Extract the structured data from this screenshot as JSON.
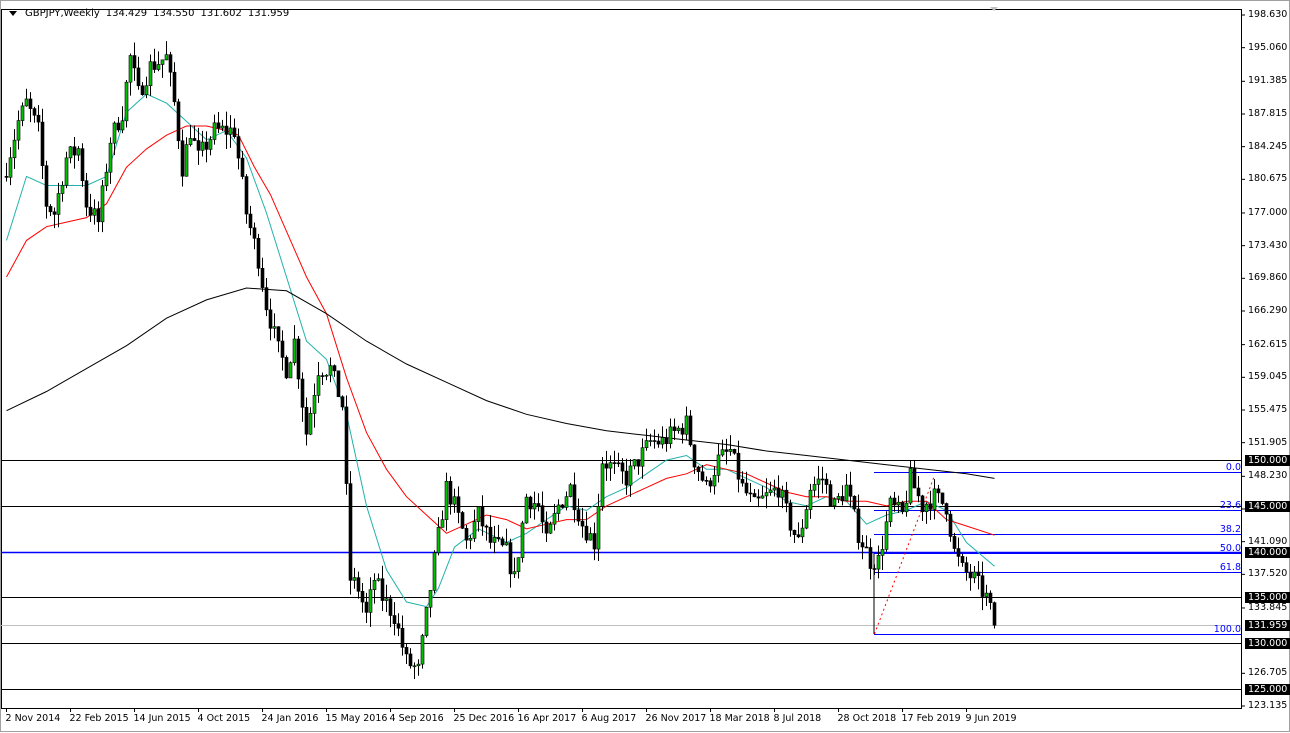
{
  "header": {
    "symbol_timeframe": "GBPJPY,Weekly",
    "open": "134.429",
    "high": "134.550",
    "low": "131.602",
    "close": "131.959"
  },
  "colors": {
    "bull": "#00c000",
    "bear": "#000000",
    "ma_fast": "#20b2aa",
    "ma_mid": "#ff0000",
    "ma_slow": "#000000",
    "fib": "#0000ff",
    "levels": "#000000"
  },
  "chart_data": {
    "type": "candlestick",
    "title": "GBPJPY,Weekly",
    "ylim": [
      123.135,
      198.63
    ],
    "y_ticks": [
      "198.630",
      "195.060",
      "191.385",
      "187.815",
      "184.245",
      "180.675",
      "177.000",
      "173.430",
      "169.860",
      "166.290",
      "162.615",
      "159.045",
      "155.475",
      "151.905",
      "148.230",
      "144.660",
      "141.090",
      "137.520",
      "133.845",
      "126.705",
      "123.135"
    ],
    "x_ticks": [
      {
        "week": 0,
        "label": "2 Nov 2014"
      },
      {
        "week": 16,
        "label": "22 Feb 2015"
      },
      {
        "week": 32,
        "label": "14 Jun 2015"
      },
      {
        "week": 48,
        "label": "4 Oct 2015"
      },
      {
        "week": 64,
        "label": "24 Jan 2016"
      },
      {
        "week": 80,
        "label": "15 May 2016"
      },
      {
        "week": 96,
        "label": "4 Sep 2016"
      },
      {
        "week": 112,
        "label": "25 Dec 2016"
      },
      {
        "week": 128,
        "label": "16 Apr 2017"
      },
      {
        "week": 144,
        "label": "6 Aug 2017"
      },
      {
        "week": 160,
        "label": "26 Nov 2017"
      },
      {
        "week": 176,
        "label": "18 Mar 2018"
      },
      {
        "week": 192,
        "label": "8 Jul 2018"
      },
      {
        "week": 208,
        "label": "28 Oct 2018"
      },
      {
        "week": 224,
        "label": "17 Feb 2019"
      },
      {
        "week": 240,
        "label": "9 Jun 2019"
      }
    ],
    "close_path": [
      [
        0,
        182
      ],
      [
        3,
        187
      ],
      [
        5,
        189
      ],
      [
        8,
        186
      ],
      [
        10,
        178
      ],
      [
        12,
        177
      ],
      [
        15,
        183
      ],
      [
        18,
        184
      ],
      [
        20,
        178
      ],
      [
        23,
        176
      ],
      [
        26,
        185
      ],
      [
        29,
        188
      ],
      [
        31,
        194
      ],
      [
        33,
        190
      ],
      [
        36,
        193
      ],
      [
        40,
        194
      ],
      [
        42,
        189
      ],
      [
        44,
        182
      ],
      [
        46,
        186
      ],
      [
        48,
        183
      ],
      [
        52,
        186
      ],
      [
        57,
        186
      ],
      [
        60,
        177
      ],
      [
        63,
        172
      ],
      [
        65,
        167
      ],
      [
        68,
        162
      ],
      [
        70,
        160
      ],
      [
        72,
        163
      ],
      [
        75,
        153
      ],
      [
        78,
        160
      ],
      [
        81,
        160
      ],
      [
        84,
        156
      ],
      [
        86,
        137
      ],
      [
        88,
        136
      ],
      [
        90,
        133
      ],
      [
        92,
        137
      ],
      [
        94,
        135
      ],
      [
        97,
        133
      ],
      [
        100,
        128
      ],
      [
        103,
        127
      ],
      [
        105,
        133
      ],
      [
        107,
        139
      ],
      [
        110,
        147
      ],
      [
        112,
        145
      ],
      [
        115,
        141
      ],
      [
        118,
        144
      ],
      [
        121,
        141
      ],
      [
        125,
        140
      ],
      [
        127,
        137
      ],
      [
        130,
        146
      ],
      [
        133,
        145
      ],
      [
        135,
        141
      ],
      [
        138,
        145
      ],
      [
        141,
        147
      ],
      [
        144,
        143
      ],
      [
        147,
        141
      ],
      [
        149,
        150
      ],
      [
        152,
        149
      ],
      [
        155,
        148
      ],
      [
        158,
        150
      ],
      [
        161,
        152
      ],
      [
        164,
        152
      ],
      [
        167,
        153
      ],
      [
        170,
        154
      ],
      [
        172,
        150
      ],
      [
        175,
        147
      ],
      [
        178,
        150
      ],
      [
        181,
        151
      ],
      [
        184,
        147
      ],
      [
        187,
        145
      ],
      [
        190,
        146
      ],
      [
        193,
        147
      ],
      [
        196,
        143
      ],
      [
        198,
        141
      ],
      [
        201,
        147
      ],
      [
        204,
        148
      ],
      [
        207,
        145
      ],
      [
        210,
        147
      ],
      [
        213,
        142
      ],
      [
        216,
        139
      ],
      [
        218,
        139
      ],
      [
        221,
        145
      ],
      [
        224,
        144
      ],
      [
        226,
        148
      ],
      [
        229,
        145
      ],
      [
        232,
        146
      ],
      [
        235,
        145
      ],
      [
        237,
        140
      ],
      [
        239,
        138
      ],
      [
        242,
        137
      ],
      [
        245,
        135
      ],
      [
        246,
        134.429
      ]
    ],
    "last_candle": {
      "open": 134.429,
      "high": 134.55,
      "low": 131.602,
      "close": 131.959
    },
    "series": [
      {
        "name": "MA fast",
        "color": "#20b2aa",
        "points": [
          [
            0,
            174
          ],
          [
            5,
            181
          ],
          [
            10,
            180
          ],
          [
            15,
            180
          ],
          [
            20,
            180
          ],
          [
            25,
            181
          ],
          [
            30,
            188
          ],
          [
            35,
            190
          ],
          [
            40,
            189
          ],
          [
            45,
            187
          ],
          [
            50,
            185
          ],
          [
            55,
            186
          ],
          [
            60,
            183
          ],
          [
            65,
            177
          ],
          [
            70,
            170
          ],
          [
            75,
            163
          ],
          [
            80,
            161
          ],
          [
            85,
            155
          ],
          [
            90,
            145
          ],
          [
            95,
            138
          ],
          [
            100,
            134.5
          ],
          [
            105,
            134
          ],
          [
            108,
            136
          ],
          [
            112,
            140.5
          ],
          [
            118,
            142.5
          ],
          [
            125,
            141
          ],
          [
            130,
            142
          ],
          [
            135,
            143.5
          ],
          [
            140,
            145
          ],
          [
            145,
            144.5
          ],
          [
            150,
            146
          ],
          [
            155,
            147
          ],
          [
            160,
            148.5
          ],
          [
            165,
            150
          ],
          [
            170,
            150.5
          ],
          [
            175,
            149
          ],
          [
            180,
            149
          ],
          [
            185,
            148
          ],
          [
            190,
            147
          ],
          [
            195,
            145.5
          ],
          [
            200,
            145
          ],
          [
            205,
            146
          ],
          [
            210,
            145.5
          ],
          [
            215,
            143
          ],
          [
            220,
            144
          ],
          [
            225,
            144.5
          ],
          [
            230,
            145.5
          ],
          [
            235,
            144.5
          ],
          [
            240,
            141
          ],
          [
            247,
            138.4
          ]
        ]
      },
      {
        "name": "MA mid",
        "color": "#ff0000",
        "points": [
          [
            0,
            170
          ],
          [
            5,
            174
          ],
          [
            10,
            175.5
          ],
          [
            15,
            176
          ],
          [
            20,
            176.5
          ],
          [
            25,
            178
          ],
          [
            30,
            182
          ],
          [
            35,
            184
          ],
          [
            40,
            185.5
          ],
          [
            45,
            186.5
          ],
          [
            50,
            186.5
          ],
          [
            55,
            186
          ],
          [
            58,
            185.5
          ],
          [
            62,
            182
          ],
          [
            66,
            179
          ],
          [
            70,
            175
          ],
          [
            75,
            170
          ],
          [
            80,
            166
          ],
          [
            85,
            159
          ],
          [
            90,
            153
          ],
          [
            95,
            149
          ],
          [
            100,
            146
          ],
          [
            105,
            144
          ],
          [
            110,
            142
          ],
          [
            115,
            143
          ],
          [
            120,
            144
          ],
          [
            125,
            143.5
          ],
          [
            130,
            142.5
          ],
          [
            135,
            143
          ],
          [
            140,
            143.5
          ],
          [
            145,
            143.5
          ],
          [
            150,
            145
          ],
          [
            155,
            146
          ],
          [
            160,
            147
          ],
          [
            165,
            148
          ],
          [
            170,
            148.5
          ],
          [
            175,
            149.5
          ],
          [
            180,
            149
          ],
          [
            185,
            148.5
          ],
          [
            190,
            147.5
          ],
          [
            195,
            146.5
          ],
          [
            200,
            146
          ],
          [
            205,
            146
          ],
          [
            210,
            145.5
          ],
          [
            215,
            145.5
          ],
          [
            220,
            145
          ],
          [
            225,
            145.5
          ],
          [
            230,
            145.5
          ],
          [
            235,
            143.5
          ],
          [
            240,
            142.8
          ],
          [
            247,
            141.8
          ]
        ]
      },
      {
        "name": "MA slow",
        "color": "#000000",
        "points": [
          [
            0,
            155.4
          ],
          [
            10,
            157.5
          ],
          [
            20,
            160
          ],
          [
            30,
            162.5
          ],
          [
            40,
            165.5
          ],
          [
            50,
            167.5
          ],
          [
            60,
            168.8
          ],
          [
            70,
            168.5
          ],
          [
            80,
            166
          ],
          [
            90,
            163
          ],
          [
            100,
            160.5
          ],
          [
            110,
            158.5
          ],
          [
            120,
            156.5
          ],
          [
            130,
            155
          ],
          [
            140,
            154
          ],
          [
            150,
            153.2
          ],
          [
            160,
            152.7
          ],
          [
            170,
            152.2
          ],
          [
            180,
            151.7
          ],
          [
            190,
            151
          ],
          [
            200,
            150.5
          ],
          [
            210,
            150
          ],
          [
            220,
            149.5
          ],
          [
            230,
            149
          ],
          [
            240,
            148.5
          ],
          [
            247,
            148
          ]
        ]
      }
    ],
    "horizontal_levels": [
      {
        "price": 150,
        "label": "150.000"
      },
      {
        "price": 145,
        "label": "145.000"
      },
      {
        "price": 140,
        "label": "140.000"
      },
      {
        "price": 135,
        "label": "135.000"
      },
      {
        "price": 130,
        "label": "130.000"
      },
      {
        "price": 125,
        "label": "125.000"
      }
    ],
    "current_price": {
      "price": 131.959,
      "label": "131.959"
    },
    "fibonacci": {
      "start_week": 217,
      "high": 148.7,
      "low": 131.0,
      "levels": [
        {
          "ratio": 0,
          "label": "0.0"
        },
        {
          "ratio": 0.236,
          "label": "23.6"
        },
        {
          "ratio": 0.382,
          "label": "38.2"
        },
        {
          "ratio": 0.5,
          "label": "50.0"
        },
        {
          "ratio": 0.618,
          "label": "61.8"
        },
        {
          "ratio": 1,
          "label": "100.0"
        }
      ]
    },
    "trendline": {
      "from": [
        217,
        131.0
      ],
      "to": [
        232,
        148.3
      ]
    }
  }
}
